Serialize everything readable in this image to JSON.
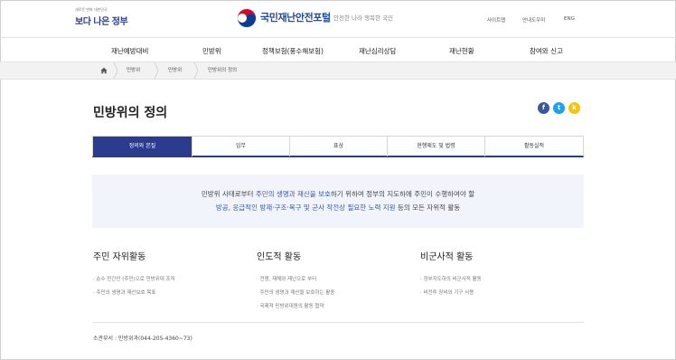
{
  "header": {
    "gov_logo_small": "새로운 변화 대한민국",
    "gov_logo_main": "보다 나은 정부",
    "portal_name": "국민재난안전포털",
    "slogan": "안전한 나라 행복한 국민",
    "util_links": [
      "사이트맵",
      "안내도우미",
      "ENG"
    ]
  },
  "gnb": [
    "재난예방대비",
    "민방위",
    "정책보험(풍수해보험)",
    "재난심리상담",
    "재난현황",
    "참여와 신고"
  ],
  "breadcrumb": [
    "민방위",
    "민방위",
    "민방위의 정의"
  ],
  "page_title": "민방위의 정의",
  "share": {
    "facebook": "f",
    "twitter": "t",
    "kakao": "k",
    "colors": {
      "facebook": "#3b5998",
      "twitter": "#1da1f2",
      "kakao": "#f7c600"
    }
  },
  "tabs": [
    {
      "label": "정의와 본질",
      "active": true
    },
    {
      "label": "임무",
      "active": false
    },
    {
      "label": "표상",
      "active": false
    },
    {
      "label": "현행제도 및 법령",
      "active": false
    },
    {
      "label": "활동실적",
      "active": false
    }
  ],
  "definition": {
    "line1_a": "민방위 사태로부터 ",
    "line1_hl": "주민의 생명과 재산을 보호",
    "line1_b": "하기 위하여 정부의 지도하에 주민이 수행하여야 할",
    "line2_hl": "방공, 응급적인 방재·구조·복구 및 군사 작전상 필요한 노력 지원",
    "line2_b": " 등의 모든 자위적 활동"
  },
  "columns": [
    {
      "title": "주민 자위활동",
      "items": [
        "· 순수 민간인 (주민)으로 민방위대 조직",
        "· 주민의 생명과 재산보호 목표"
      ]
    },
    {
      "title": "인도적 활동",
      "items": [
        "· 전쟁, 재해와 재난으로 부터",
        "  주민의 생명과 재산을 보호하는 활동",
        "· 국제적 민방위대원의 활동 협약"
      ]
    },
    {
      "title": "비군사적 활동",
      "items": [
        "· 정부지도하의 비군사적 활동",
        "· 비전투 장비와 기구 사용"
      ]
    }
  ],
  "footer": {
    "department": "소관부서 : 민방위과(044-205-4360~73)"
  },
  "colors": {
    "accent": "#2b3c8f",
    "highlight": "#3b56a8",
    "desc_bg": "#f1f5fb"
  }
}
